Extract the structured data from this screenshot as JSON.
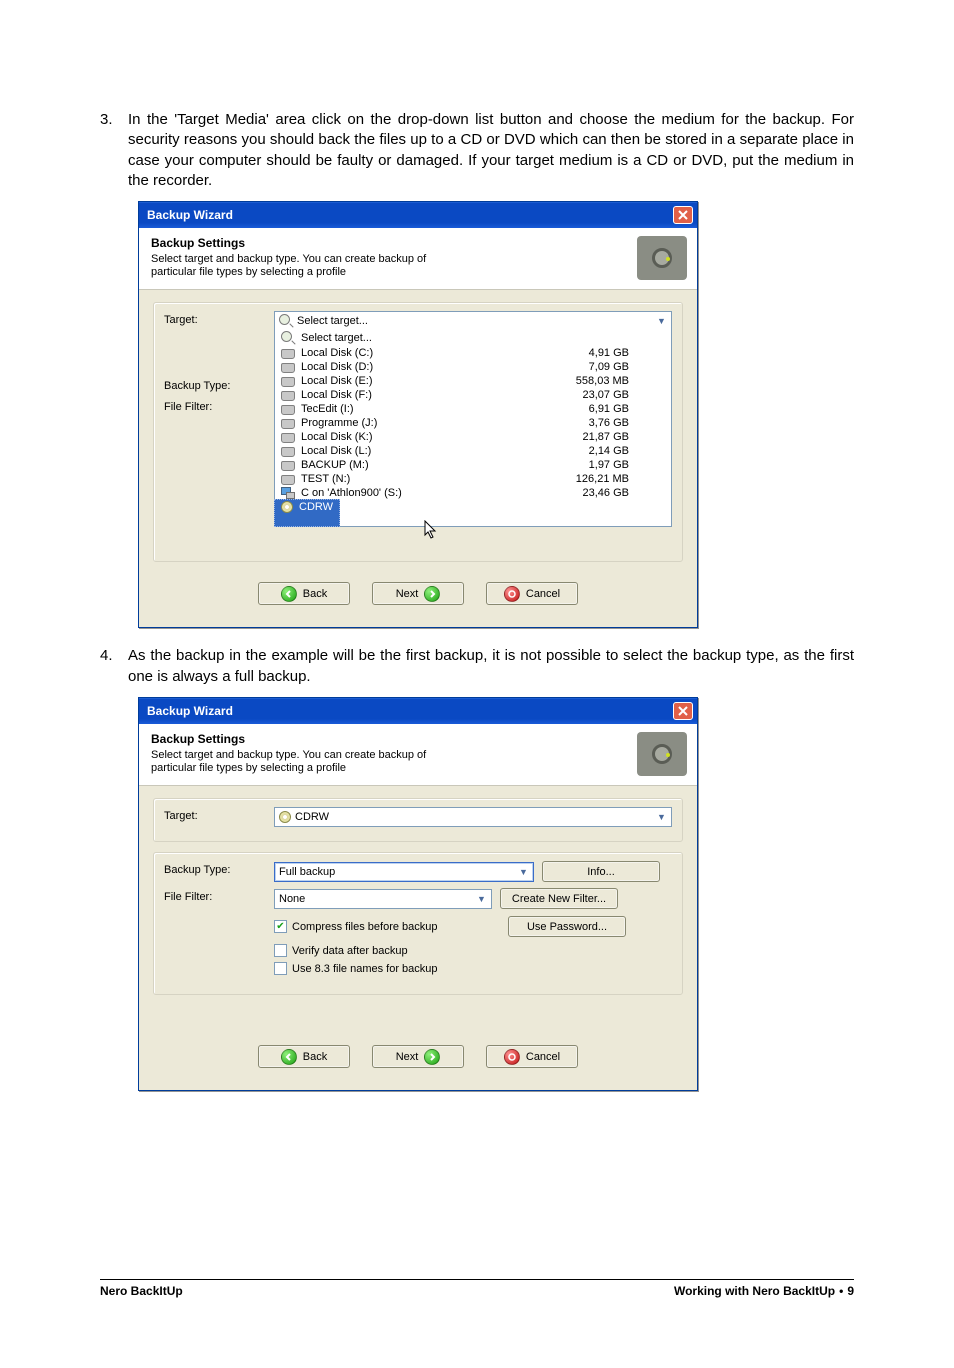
{
  "steps": {
    "s3_num": "3.",
    "s3_text": "In the 'Target Media' area click on the drop-down list button and choose the medium for the backup. For security reasons you should back the files up to a CD or DVD which can then be stored in a separate place in case your computer should be faulty or damaged. If your target medium is a CD or DVD, put the medium in the recorder.",
    "s4_num": "4.",
    "s4_text": "As the backup in the example will be the first backup, it is not possible to select the backup type, as the first one is always a full backup."
  },
  "dialog": {
    "title": "Backup Wizard",
    "header_title": "Backup Settings",
    "header_desc": "Select target and backup type. You can create backup of particular file types by selecting a profile",
    "labels": {
      "target": "Target:",
      "backup_type": "Backup Type:",
      "file_filter": "File Filter:"
    },
    "combo_select_target": "Select target...",
    "dropdown": [
      {
        "label": "Select target...",
        "size": ""
      },
      {
        "label": "Local Disk (C:)",
        "size": "4,91 GB"
      },
      {
        "label": "Local Disk (D:)",
        "size": "7,09 GB"
      },
      {
        "label": "Local Disk (E:)",
        "size": "558,03 MB"
      },
      {
        "label": "Local Disk (F:)",
        "size": "23,07 GB"
      },
      {
        "label": "TecEdit (I:)",
        "size": "6,91 GB"
      },
      {
        "label": "Programme (J:)",
        "size": "3,76 GB"
      },
      {
        "label": "Local Disk (K:)",
        "size": "21,87 GB"
      },
      {
        "label": "Local Disk (L:)",
        "size": "2,14 GB"
      },
      {
        "label": "BACKUP (M:)",
        "size": "1,97 GB"
      },
      {
        "label": "TEST (N:)",
        "size": "126,21 MB"
      },
      {
        "label": "C on 'Athlon900' (S:)",
        "size": "23,46 GB"
      },
      {
        "label": "CDRW",
        "size": ""
      }
    ],
    "buttons": {
      "back": "Back",
      "next": "Next",
      "cancel": "Cancel"
    }
  },
  "dialog2": {
    "target_value": "CDRW",
    "backup_type_value": "Full backup",
    "file_filter_value": "None",
    "info_btn": "Info...",
    "create_filter_btn": "Create New Filter...",
    "use_pw_btn": "Use Password...",
    "cb_compress": "Compress files before backup",
    "cb_verify": "Verify data after backup",
    "cb_83": "Use 8.3 file names for backup"
  },
  "footer": {
    "left": "Nero BackItUp",
    "right_title": "Working with Nero BackItUp",
    "page": "9"
  }
}
